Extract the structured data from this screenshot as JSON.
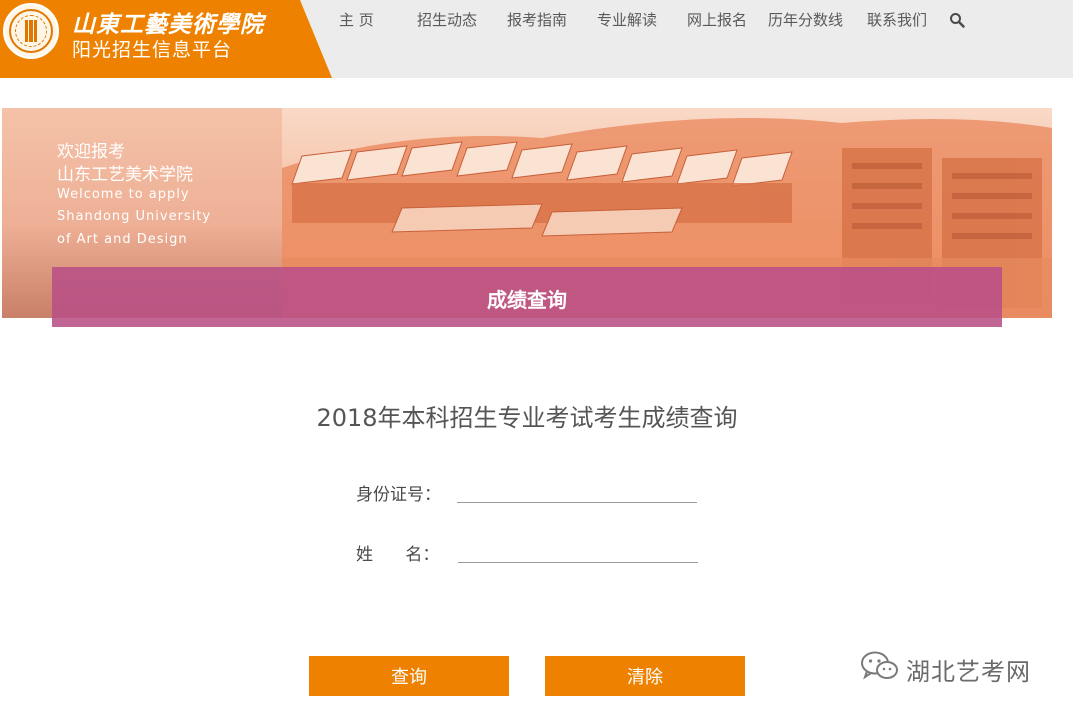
{
  "header": {
    "school_name": "山東工藝美術學院",
    "platform_name": "阳光招生信息平台",
    "nav": [
      {
        "label": "主  页"
      },
      {
        "label": "招生动态"
      },
      {
        "label": "报考指南"
      },
      {
        "label": "专业解读"
      },
      {
        "label": "网上报名"
      },
      {
        "label": "历年分数线"
      },
      {
        "label": "联系我们"
      }
    ],
    "search_icon": "search-icon"
  },
  "banner": {
    "welcome_cn_1": "欢迎报考",
    "welcome_cn_2": "山东工艺美术学院",
    "welcome_en_1": "Welcome to apply",
    "welcome_en_2": "Shandong University",
    "welcome_en_3": "of Art and Design",
    "section_title": "成绩查询"
  },
  "form": {
    "title": "2018年本科招生专业考试考生成绩查询",
    "id_label": "身份证号：",
    "id_value": "",
    "name_label": "姓      名：",
    "name_value": "",
    "query_button": "查询",
    "clear_button": "清除"
  },
  "watermark": {
    "text": "湖北艺考网",
    "icon": "wechat-icon"
  },
  "colors": {
    "brand_orange": "#ee8200",
    "header_bg": "#ececec",
    "query_bar": "#b85086",
    "banner_tint": "#ee8a5a"
  }
}
